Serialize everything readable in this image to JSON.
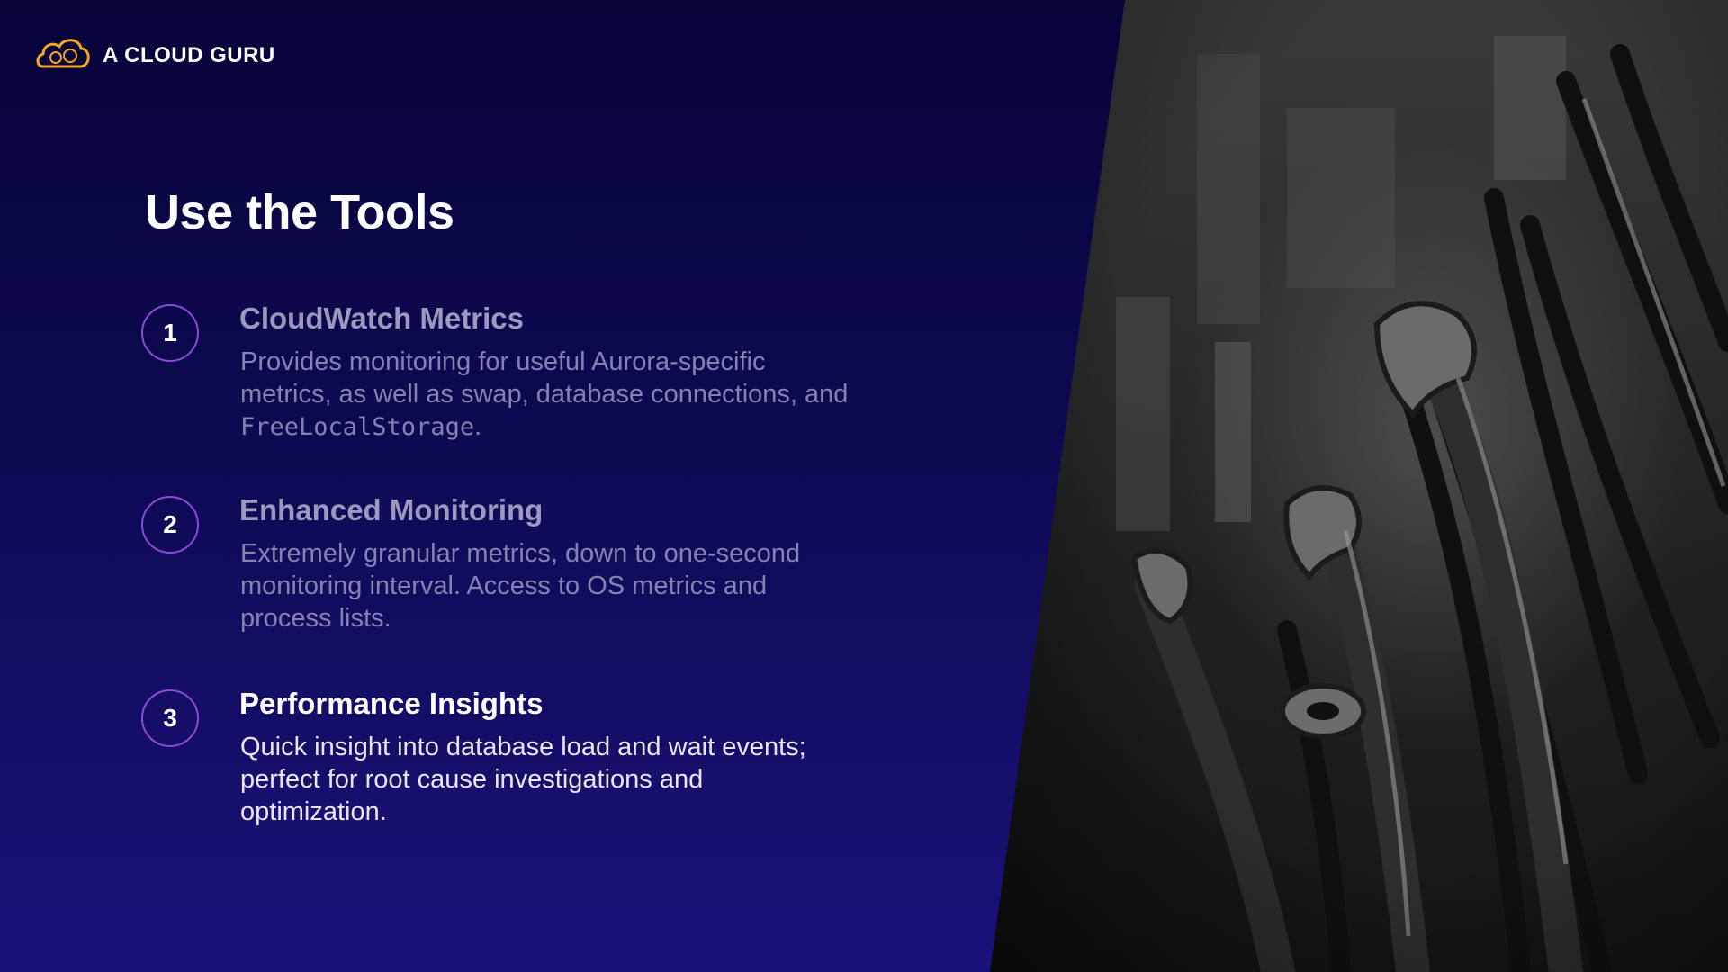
{
  "brand": {
    "name": "A CLOUD GURU",
    "accent_color": "#f5a623",
    "icon": "cloud-logo-icon"
  },
  "slide": {
    "title": "Use the Tools",
    "circle_color": "#8a4bd6",
    "image": "wrenches-and-pliers-photo"
  },
  "items": [
    {
      "number": "1",
      "heading": "CloudWatch Metrics",
      "desc_before": "Provides monitoring for useful Aurora-specific metrics, as well as swap, database connections, and ",
      "desc_code": "FreeLocalStorage",
      "desc_after": "."
    },
    {
      "number": "2",
      "heading": "Enhanced Monitoring",
      "desc": "Extremely granular metrics, down to one-second monitoring interval. Access to OS metrics and process lists."
    },
    {
      "number": "3",
      "heading": "Performance Insights",
      "desc": "Quick insight into database load and wait events; perfect for root cause investigations and optimization."
    }
  ]
}
